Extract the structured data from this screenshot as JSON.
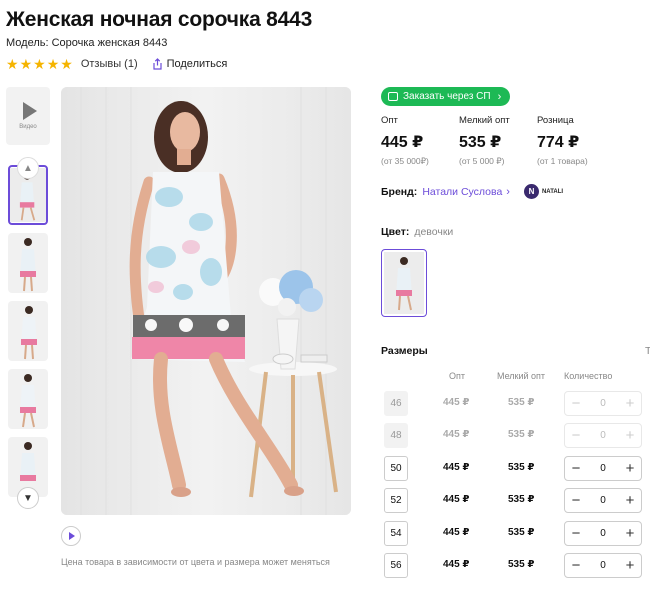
{
  "product": {
    "title": "Женская ночная сорочка 8443",
    "model": "Модель: Сорочка женская 8443",
    "rating": 5,
    "reviews_label": "Отзывы (1)",
    "share_label": "Поделиться"
  },
  "gallery": {
    "video_label": "Видео",
    "note": "Цена товара в зависимости от цвета и размера может меняться"
  },
  "order_button": "Заказать через СП",
  "prices": [
    {
      "label": "Опт",
      "value": "445 ₽",
      "condition": "(от 35 000₽)"
    },
    {
      "label": "Мелкий опт",
      "value": "535 ₽",
      "condition": "(от 5 000 ₽)"
    },
    {
      "label": "Розница",
      "value": "774 ₽",
      "condition": "(от 1 товара)"
    }
  ],
  "brand": {
    "label": "Бренд:",
    "name": "Натали Суслова",
    "logo_text": "NATALI"
  },
  "color": {
    "label": "Цвет:",
    "value": "девочки"
  },
  "sizes": {
    "title": "Размеры",
    "extra": "Т",
    "headers": {
      "opt": "Опт",
      "small_opt": "Мелкий опт",
      "quantity": "Количество"
    },
    "rows": [
      {
        "size": "46",
        "opt": "445 ₽",
        "small_opt": "535 ₽",
        "qty": "0",
        "available": false
      },
      {
        "size": "48",
        "opt": "445 ₽",
        "small_opt": "535 ₽",
        "qty": "0",
        "available": false
      },
      {
        "size": "50",
        "opt": "445 ₽",
        "small_opt": "535 ₽",
        "qty": "0",
        "available": true
      },
      {
        "size": "52",
        "opt": "445 ₽",
        "small_opt": "535 ₽",
        "qty": "0",
        "available": true
      },
      {
        "size": "54",
        "opt": "445 ₽",
        "small_opt": "535 ₽",
        "qty": "0",
        "available": true
      },
      {
        "size": "56",
        "opt": "445 ₽",
        "small_opt": "535 ₽",
        "qty": "0",
        "available": true
      }
    ]
  },
  "colors": {
    "accent": "#6c4cd9",
    "order_green": "#1db955",
    "star": "#f5b400"
  }
}
